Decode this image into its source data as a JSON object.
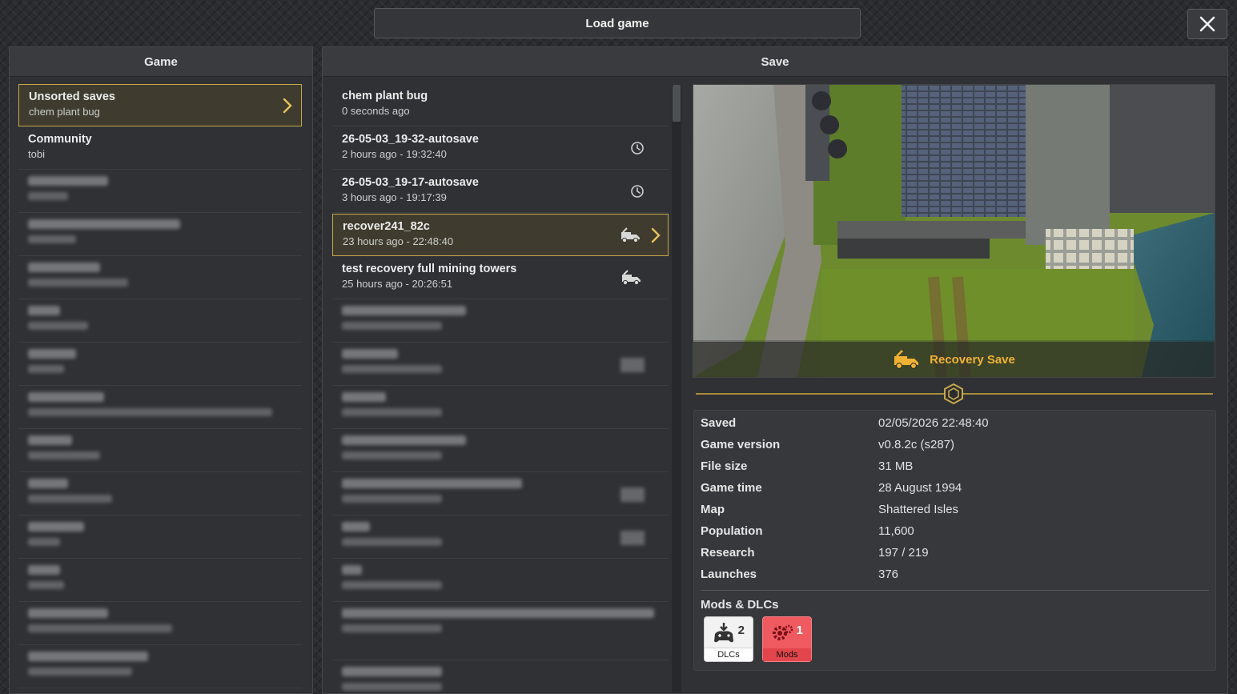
{
  "window": {
    "title": "Load game"
  },
  "game_panel": {
    "header": "Game",
    "items": [
      {
        "title": "Unsorted saves",
        "subtitle": "chem plant bug",
        "selected": true
      },
      {
        "title": "Community",
        "subtitle": "tobi"
      }
    ],
    "blurred_count": 12
  },
  "save_panel": {
    "header": "Save",
    "items": [
      {
        "title": "chem plant bug",
        "subtitle": "0 seconds ago",
        "icon": "none"
      },
      {
        "title": "26-05-03_19-32-autosave",
        "subtitle": "2 hours ago - 19:32:40",
        "icon": "clock-icon"
      },
      {
        "title": "26-05-03_19-17-autosave",
        "subtitle": "3 hours ago - 19:17:39",
        "icon": "clock-icon"
      },
      {
        "title": "recover241_82c",
        "subtitle": "23 hours ago - 22:48:40",
        "icon": "recovery-truck-icon",
        "selected": true
      },
      {
        "title": "test recovery full mining towers",
        "subtitle": "25 hours ago - 20:26:51",
        "icon": "recovery-truck-icon"
      }
    ],
    "blurred_count": 9
  },
  "preview": {
    "badge_text": "Recovery Save"
  },
  "details": [
    {
      "key": "Saved",
      "value": "02/05/2026 22:48:40"
    },
    {
      "key": "Game version",
      "value": "v0.8.2c (s287)"
    },
    {
      "key": "File size",
      "value": "31 MB"
    },
    {
      "key": "Game time",
      "value": "28 August 1994"
    },
    {
      "key": "Map",
      "value": "Shattered Isles"
    },
    {
      "key": "Population",
      "value": "11,600"
    },
    {
      "key": "Research",
      "value": "197 / 219"
    },
    {
      "key": "Launches",
      "value": "376"
    }
  ],
  "mods_section": {
    "title": "Mods & DLCs",
    "dlcs": {
      "count": "2",
      "label": "DLCs"
    },
    "mods": {
      "count": "1",
      "label": "Mods"
    }
  },
  "colors": {
    "accent": "#c8a84a",
    "recovery": "#f1b233",
    "mods": "#e2454b"
  }
}
